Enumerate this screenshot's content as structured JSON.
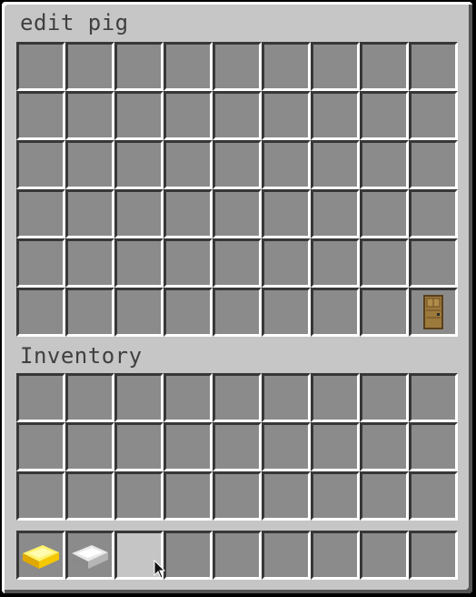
{
  "container": {
    "title": "edit pig",
    "rows": 6,
    "cols": 9,
    "items": [
      {
        "row": 5,
        "col": 8,
        "item": "oak-door-icon"
      }
    ]
  },
  "inventory": {
    "title": "Inventory",
    "rows": 3,
    "cols": 9,
    "items": []
  },
  "hotbar": {
    "cols": 9,
    "items": [
      {
        "col": 0,
        "item": "gold-ingot-icon"
      },
      {
        "col": 1,
        "item": "iron-ingot-icon"
      }
    ],
    "hovered_col": 2
  },
  "colors": {
    "panel": "#c6c6c6",
    "slot": "#8b8b8b",
    "slot_hover": "#c5c5c5",
    "text": "#404040"
  }
}
